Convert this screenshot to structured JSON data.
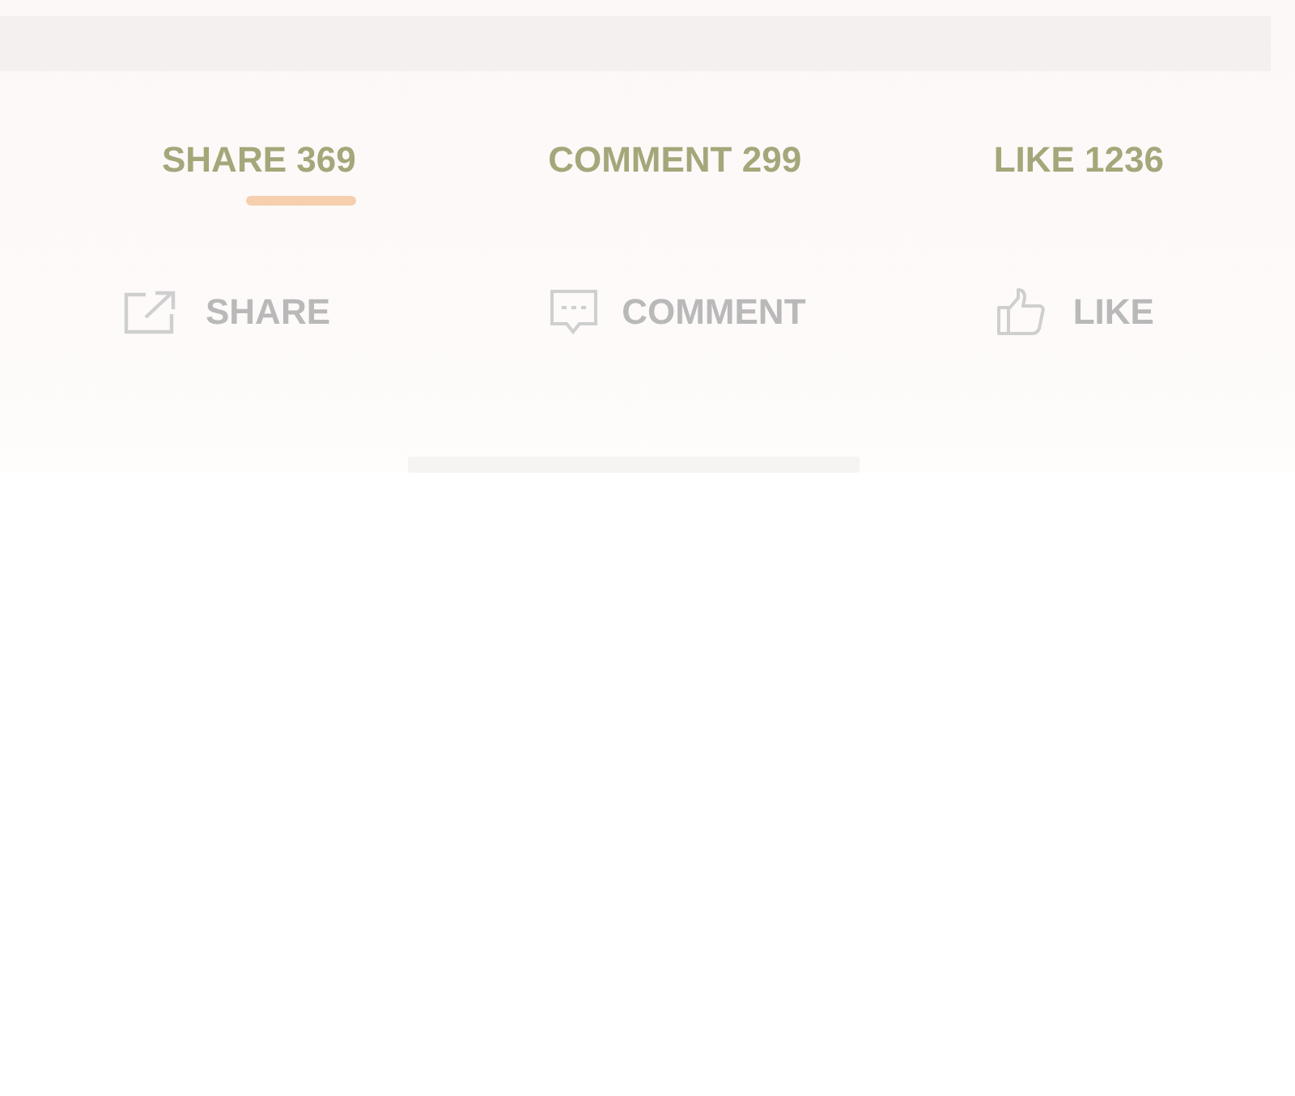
{
  "tabs": [
    {
      "label": "SHARE 369",
      "selected": true
    },
    {
      "label": "COMMENT 299",
      "selected": false
    },
    {
      "label": "LIKE 1236",
      "selected": false
    }
  ],
  "actions": [
    {
      "kind": "share",
      "label": "SHARE"
    },
    {
      "kind": "comment",
      "label": "COMMENT"
    },
    {
      "kind": "like",
      "label": "LIKE"
    }
  ]
}
